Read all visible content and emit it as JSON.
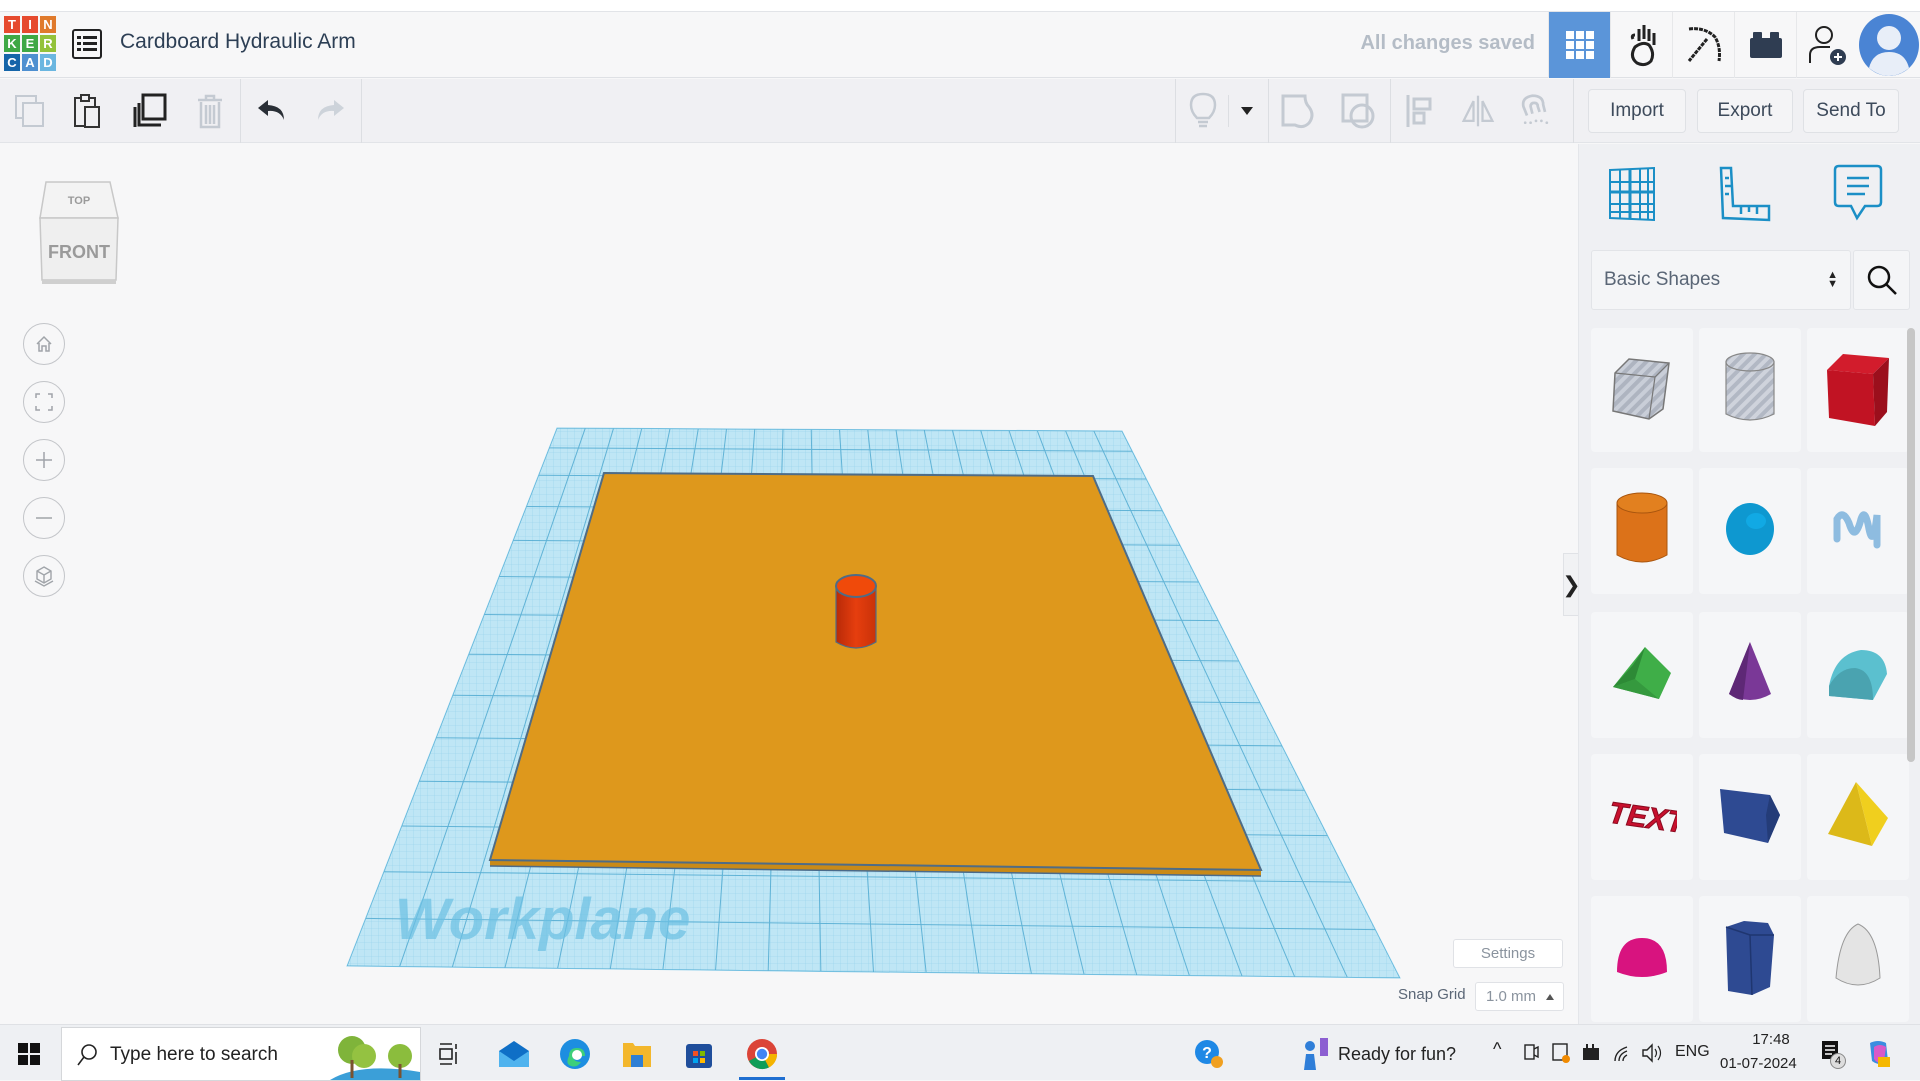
{
  "app": {
    "logo_letters": [
      "T",
      "I",
      "N",
      "K",
      "E",
      "R",
      "C",
      "A",
      "D"
    ],
    "logo_colors": [
      "#e64a2e",
      "#e64a2e",
      "#e07a2c",
      "#3fa845",
      "#3fa845",
      "#93c23a",
      "#1565a9",
      "#4e8fd0",
      "#6ab6e0"
    ],
    "document_title": "Cardboard Hydraulic Arm",
    "save_status": "All changes saved",
    "accent_color": "#5b95d9"
  },
  "header_buttons": [
    {
      "name": "3d-design-view",
      "icon": "grid-icon",
      "active": true
    },
    {
      "name": "blocks-view",
      "icon": "hand-apple-icon",
      "active": false
    },
    {
      "name": "minecraft-view",
      "icon": "pickaxe-icon",
      "active": false
    },
    {
      "name": "lego-view",
      "icon": "brick-icon",
      "active": false
    },
    {
      "name": "invite-user",
      "icon": "add-user-icon",
      "active": false
    },
    {
      "name": "profile",
      "icon": "avatar-icon",
      "active": false
    }
  ],
  "toolbar": {
    "left_tools": [
      {
        "name": "copy",
        "icon": "copy-icon",
        "enabled": false
      },
      {
        "name": "paste",
        "icon": "paste-icon",
        "enabled": true
      },
      {
        "name": "duplicate",
        "icon": "duplicate-icon",
        "enabled": true
      },
      {
        "name": "delete",
        "icon": "trash-icon",
        "enabled": false
      },
      {
        "name": "undo",
        "icon": "undo-icon",
        "enabled": true
      },
      {
        "name": "redo",
        "icon": "redo-icon",
        "enabled": false
      }
    ],
    "right_tools": [
      {
        "name": "notes",
        "icon": "lightbulb-icon"
      },
      {
        "name": "notes-dropdown",
        "icon": "caret-down-icon"
      },
      {
        "name": "group",
        "icon": "group-icon"
      },
      {
        "name": "ungroup",
        "icon": "ungroup-icon"
      },
      {
        "name": "align",
        "icon": "align-icon"
      },
      {
        "name": "mirror",
        "icon": "mirror-icon"
      },
      {
        "name": "cruise",
        "icon": "magnet-icon"
      }
    ],
    "import_label": "Import",
    "export_label": "Export",
    "send_to_label": "Send To"
  },
  "viewport": {
    "viewcube_top": "TOP",
    "viewcube_front": "FRONT",
    "nav_buttons": [
      "home-view",
      "fit-all",
      "zoom-in",
      "zoom-out",
      "perspective"
    ],
    "workplane_label": "Workplane",
    "settings_label": "Settings",
    "snap_grid_label": "Snap Grid",
    "snap_grid_value": "1.0 mm",
    "objects": [
      {
        "name": "cardboard-base-plate",
        "color": "#de981c"
      },
      {
        "name": "red-cylinder",
        "color": "#e13b0c"
      }
    ],
    "collapse_label": "❯"
  },
  "panel": {
    "top_icons": [
      "workplane-icon",
      "ruler-icon",
      "notes-icon"
    ],
    "library_select": "Basic Shapes",
    "shapes": [
      {
        "name": "box-hole"
      },
      {
        "name": "cylinder-hole"
      },
      {
        "name": "box",
        "color": "#c8102e"
      },
      {
        "name": "cylinder",
        "color": "#e07b1b"
      },
      {
        "name": "sphere",
        "color": "#0e98d0"
      },
      {
        "name": "scribble",
        "color": "#8ebce0"
      },
      {
        "name": "roof",
        "color": "#3fae48"
      },
      {
        "name": "cone",
        "color": "#7a3897"
      },
      {
        "name": "round-roof",
        "color": "#5bc0cf"
      },
      {
        "name": "text",
        "color": "#c8102e",
        "label": "TEXT"
      },
      {
        "name": "polygon-prism",
        "color": "#2e4a92"
      },
      {
        "name": "pyramid",
        "color": "#e6c41a"
      },
      {
        "name": "half-sphere",
        "color": "#d8137f"
      },
      {
        "name": "hexagonal-prism",
        "color": "#2e4a92"
      },
      {
        "name": "paraboloid",
        "color": "#d8d8d8"
      }
    ]
  },
  "taskbar": {
    "search_placeholder": "Type here to search",
    "apps": [
      "task-view",
      "mail",
      "edge",
      "file-explorer",
      "store",
      "chrome"
    ],
    "active_app": "chrome",
    "widget_text": "Ready for fun?",
    "language": "ENG",
    "time": "17:48",
    "date": "01-07-2024",
    "notification_count": "4"
  }
}
